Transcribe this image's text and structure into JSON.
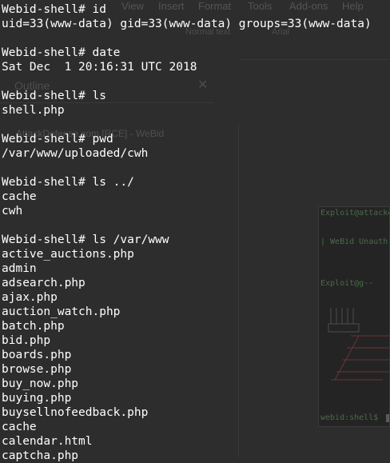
{
  "background_app": {
    "menu": [
      "View",
      "Insert",
      "Format",
      "Tools",
      "Add-ons",
      "Help"
    ],
    "toolbar": [
      "Normal text",
      "Arial"
    ],
    "outline_title": "Outline",
    "outline_close": "✕",
    "outline_entry": "AttackDefense.com [RCE] - WeBid"
  },
  "inset_terminal": {
    "lines": [
      "Exploit@attacker",
      "| WeBid Unauth",
      "Exploit@g--",
      "webid:shell$"
    ]
  },
  "terminal": {
    "prompt": "Webid-shell#",
    "blocks": [
      {
        "command": "id",
        "output": [
          "uid=33(www-data) gid=33(www-data) groups=33(www-data)"
        ]
      },
      {
        "command": "date",
        "output": [
          "Sat Dec  1 20:16:31 UTC 2018"
        ]
      },
      {
        "command": "ls",
        "output": [
          "shell.php"
        ]
      },
      {
        "command": "pwd",
        "output": [
          "/var/www/uploaded/cwh"
        ]
      },
      {
        "command": "ls ../",
        "output": [
          "cache",
          "cwh"
        ]
      },
      {
        "command": "ls /var/www",
        "output": [
          "active_auctions.php",
          "admin",
          "adsearch.php",
          "ajax.php",
          "auction_watch.php",
          "batch.php",
          "bid.php",
          "boards.php",
          "browse.php",
          "buy_now.php",
          "buying.php",
          "buysellnofeedback.php",
          "cache",
          "calendar.html",
          "captcha.php"
        ]
      }
    ]
  },
  "colors": {
    "background": "#2d2d2d",
    "text": "#ffffff"
  }
}
